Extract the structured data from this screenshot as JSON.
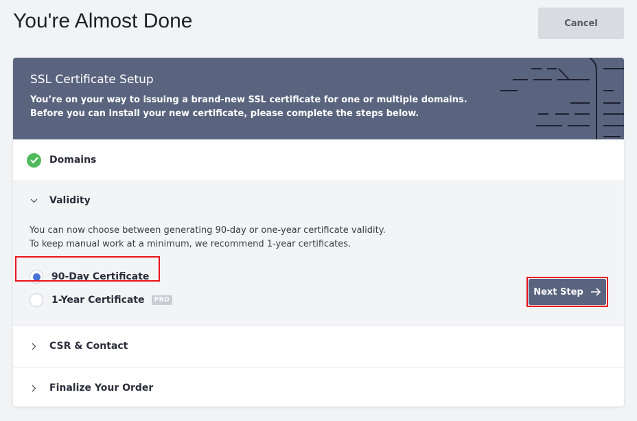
{
  "header": {
    "title": "You're Almost Done",
    "cancel_label": "Cancel"
  },
  "banner": {
    "title": "SSL Certificate Setup",
    "desc_line1": "You’re on your way to issuing a brand-new SSL certificate for one or multiple domains.",
    "desc_line2": "Before you can install your new certificate, please complete the steps below."
  },
  "steps": {
    "domains": {
      "label": "Domains",
      "status": "completed"
    },
    "validity": {
      "label": "Validity",
      "text_line1": "You can now choose between generating 90-day or one-year certificate validity.",
      "text_line2": "To keep manual work at a minimum, we recommend 1-year certificates.",
      "options": [
        {
          "label": "90-Day Certificate",
          "selected": true
        },
        {
          "label": "1-Year Certificate",
          "selected": false,
          "badge": "PRO"
        }
      ],
      "next_label": "Next Step"
    },
    "csr": {
      "label": "CSR & Contact"
    },
    "finalize": {
      "label": "Finalize Your Order"
    }
  },
  "colors": {
    "banner": "#5a647f",
    "success": "#4fba5b",
    "radio_selected": "#4a72d6",
    "highlight": "#e8131b"
  }
}
